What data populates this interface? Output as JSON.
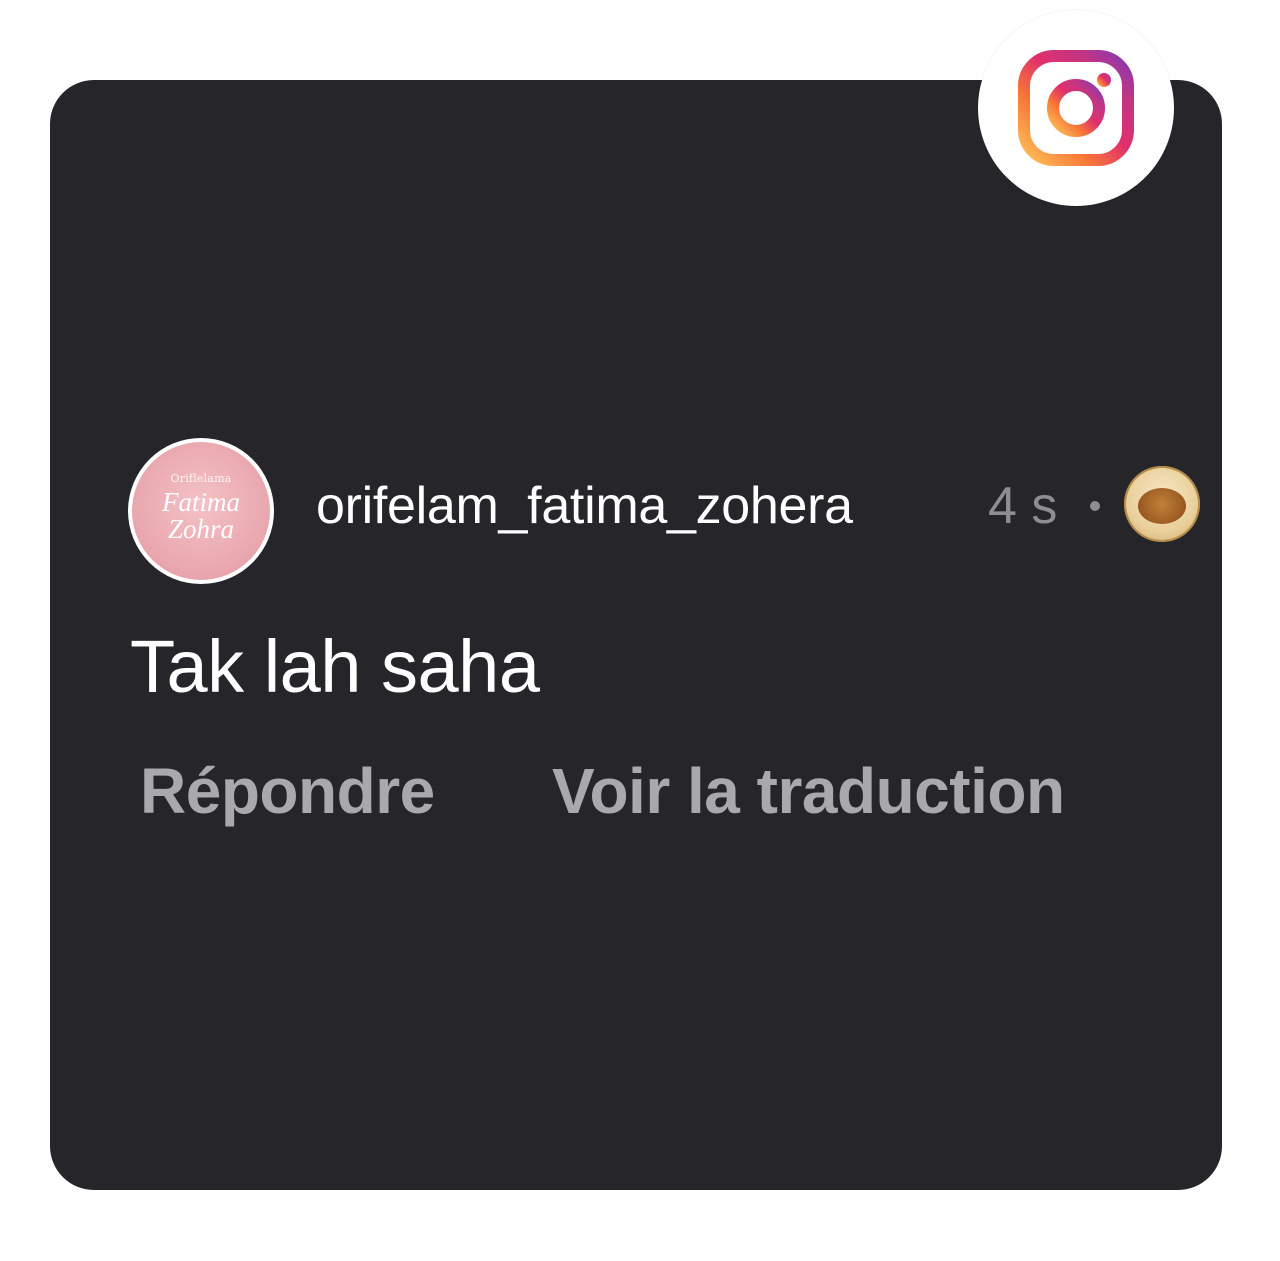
{
  "comment": {
    "avatar": {
      "small_text": "Oriflelama",
      "script_line1": "Fatima",
      "script_line2": "Zohra"
    },
    "username": "orifelam_fatima_zohera",
    "time": "4 s",
    "text": "Tak lah saha",
    "actions": {
      "reply_label": "Répondre",
      "translate_label": "Voir la traduction"
    }
  },
  "badge": {
    "icon": "instagram-icon"
  },
  "colors": {
    "card_background": "#25252a",
    "primary_text": "#ffffff",
    "secondary_text": "#8d8d92",
    "action_text": "#a8a8ad"
  }
}
